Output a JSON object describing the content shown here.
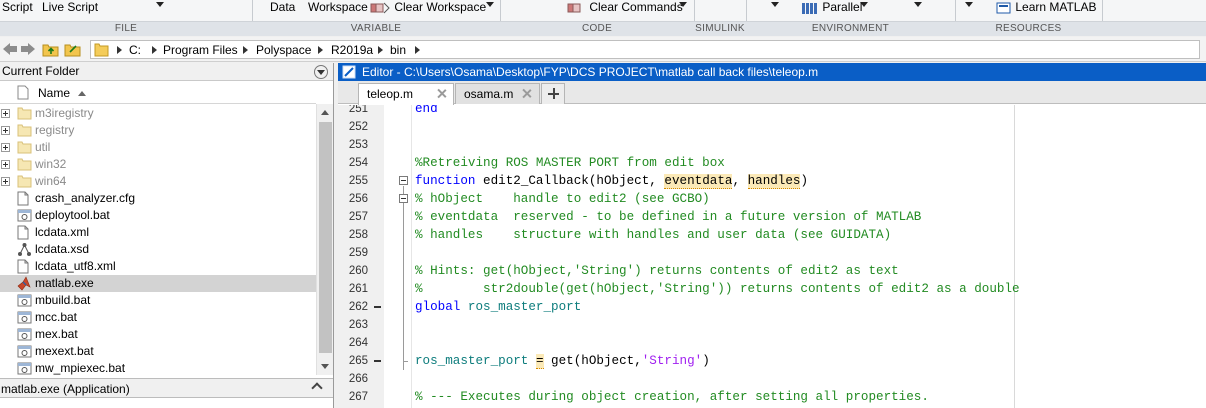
{
  "ribbon": {
    "items": {
      "script": "Script",
      "live_script": "Live Script",
      "data": "Data",
      "workspace": "Workspace",
      "clear_workspace": "Clear Workspace",
      "clear_commands": "Clear Commands",
      "parallel": "Parallel",
      "learn_matlab": "Learn MATLAB"
    },
    "sections": {
      "file": "FILE",
      "variable": "VARIABLE",
      "code": "CODE",
      "simulink": "SIMULINK",
      "environment": "ENVIRONMENT",
      "resources": "RESOURCES"
    }
  },
  "address": {
    "crumbs": [
      "C:",
      "Program Files",
      "Polyspace",
      "R2019a",
      "bin"
    ]
  },
  "current_folder": {
    "title": "Current Folder",
    "column_name": "Name",
    "sort": "ascending",
    "files": [
      {
        "name": "m3iregistry",
        "type": "folder",
        "dimmed": true
      },
      {
        "name": "registry",
        "type": "folder",
        "dimmed": true
      },
      {
        "name": "util",
        "type": "folder",
        "dimmed": true
      },
      {
        "name": "win32",
        "type": "folder",
        "dimmed": true
      },
      {
        "name": "win64",
        "type": "folder",
        "dimmed": true
      },
      {
        "name": "crash_analyzer.cfg",
        "type": "file"
      },
      {
        "name": "deploytool.bat",
        "type": "bat"
      },
      {
        "name": "lcdata.xml",
        "type": "file"
      },
      {
        "name": "lcdata.xsd",
        "type": "xsd"
      },
      {
        "name": "lcdata_utf8.xml",
        "type": "file"
      },
      {
        "name": "matlab.exe",
        "type": "exe",
        "selected": true
      },
      {
        "name": "mbuild.bat",
        "type": "bat"
      },
      {
        "name": "mcc.bat",
        "type": "bat"
      },
      {
        "name": "mex.bat",
        "type": "bat"
      },
      {
        "name": "mexext.bat",
        "type": "bat"
      },
      {
        "name": "mw_mpiexec.bat",
        "type": "bat"
      }
    ],
    "details": "matlab.exe  (Application)"
  },
  "editor": {
    "title": "Editor - C:\\Users\\Osama\\Desktop\\FYP\\DCS PROJECT\\matlab call back files\\teleop.m",
    "tabs": [
      {
        "label": "teleop.m",
        "active": true
      },
      {
        "label": "osama.m",
        "active": false
      }
    ],
    "lines": [
      {
        "n": "251",
        "parts": [
          {
            "t": "end",
            "c": "kw"
          }
        ],
        "partial": true
      },
      {
        "n": "252",
        "parts": []
      },
      {
        "n": "253",
        "parts": []
      },
      {
        "n": "254",
        "parts": [
          {
            "t": "%Retreiving ROS MASTER PORT from edit box",
            "c": "cm"
          }
        ]
      },
      {
        "n": "255",
        "parts": [
          {
            "t": "function ",
            "c": "kw"
          },
          {
            "t": "edit2_Callback(hObject, "
          },
          {
            "t": "eventdata",
            "c": "warn"
          },
          {
            "t": ", "
          },
          {
            "t": "handles",
            "c": "warn"
          },
          {
            "t": ")"
          }
        ]
      },
      {
        "n": "256",
        "parts": [
          {
            "t": "% hObject    handle to edit2 (see GCBO)",
            "c": "cm"
          }
        ]
      },
      {
        "n": "257",
        "parts": [
          {
            "t": "% eventdata  reserved - to be defined in a future version of MATLAB",
            "c": "cm"
          }
        ]
      },
      {
        "n": "258",
        "parts": [
          {
            "t": "% handles    structure with handles and user data (see GUIDATA)",
            "c": "cm"
          }
        ]
      },
      {
        "n": "259",
        "parts": []
      },
      {
        "n": "260",
        "parts": [
          {
            "t": "% Hints: get(hObject,'String') returns contents of edit2 as text",
            "c": "cm"
          }
        ]
      },
      {
        "n": "261",
        "parts": [
          {
            "t": "%        str2double(get(hObject,'String')) returns contents of edit2 as a double",
            "c": "cm"
          }
        ]
      },
      {
        "n": "262",
        "dash": true,
        "parts": [
          {
            "t": "global ",
            "c": "kw"
          },
          {
            "t": "ros_master_port",
            "c": "var"
          }
        ]
      },
      {
        "n": "263",
        "parts": []
      },
      {
        "n": "264",
        "parts": []
      },
      {
        "n": "265",
        "dash": true,
        "parts": [
          {
            "t": "ros_master_port",
            "c": "var"
          },
          {
            "t": " "
          },
          {
            "t": "=",
            "c": "warn"
          },
          {
            "t": " get(hObject,"
          },
          {
            "t": "'String'",
            "c": "str"
          },
          {
            "t": ")"
          }
        ]
      },
      {
        "n": "266",
        "parts": []
      },
      {
        "n": "267",
        "parts": [
          {
            "t": "% --- Executes during object creation, after setting all properties.",
            "c": "cm"
          }
        ]
      }
    ]
  },
  "colors": {
    "editor_title_bg": "#0a5ec6",
    "keyword": "#0000ff",
    "comment": "#228b22",
    "string": "#a020f0",
    "global_var": "#0e7d7d",
    "selection": "#d3d3d3"
  }
}
